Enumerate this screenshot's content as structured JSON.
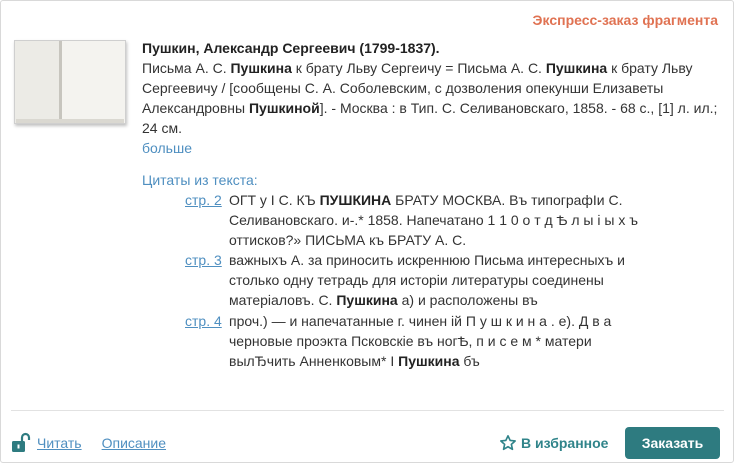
{
  "express_label": "Экспресс-заказ фрагмента",
  "book": {
    "title": "Пушкин, Александр Сергеевич (1799-1837).",
    "desc_parts": [
      {
        "t": "Письма А. С. ",
        "b": false
      },
      {
        "t": "Пушкина",
        "b": true
      },
      {
        "t": " к брату Льву Сергеичу = Письма А. С. ",
        "b": false
      },
      {
        "t": "Пушкина",
        "b": true
      },
      {
        "t": " к брату Льву Сергеевичу / [сообщены С. А. Соболевским, с дозволения опекунши Елизаветы Александровны ",
        "b": false
      },
      {
        "t": "Пушкиной",
        "b": true
      },
      {
        "t": "]. - Москва : в Тип. С. Селивановскаго, 1858. - 68 с., [1] л. ил.; 24 см.",
        "b": false
      }
    ],
    "more_label": "больше"
  },
  "quotes": {
    "title": "Цитаты из текста:",
    "items": [
      {
        "page": "стр. 2",
        "parts": [
          {
            "t": "ОГТ у І С. КЪ ",
            "b": false
          },
          {
            "t": "ПУШКИНА",
            "b": true
          },
          {
            "t": " БРАТУ МОСКВА. Въ типографІи С. Селивановскаго. и-.* 1858. Напечатано 1 1 0 о т д Ѣ л ы і ы х ъ оттисков?» ПИСЬМА къ БРАТУ А. С.",
            "b": false
          }
        ]
      },
      {
        "page": "стр. 3",
        "parts": [
          {
            "t": "важныхъ А. за приносить искреннюю Письма интересныхъ и столько одну тетрадь для исторіи литературы соединены матеріаловъ. С. ",
            "b": false
          },
          {
            "t": "Пушкина",
            "b": true
          },
          {
            "t": " а) и расположены въ",
            "b": false
          }
        ]
      },
      {
        "page": "стр. 4",
        "parts": [
          {
            "t": "проч.) — и напечатанные г. чинен ій П у ш к и н а . е). Д в а черновые проэкта Псковскіе въ ногѢ, п и с е м * матери вылЂчить Анненковым* І ",
            "b": false
          },
          {
            "t": "Пушкина",
            "b": true
          },
          {
            "t": " бъ",
            "b": false
          }
        ]
      }
    ]
  },
  "actions": {
    "read_label": "Читать",
    "description_label": "Описание",
    "favorites_label": "В избранное",
    "order_label": "Заказать"
  },
  "colors": {
    "accent_orange": "#e07252",
    "link_blue": "#4f8fc0",
    "teal": "#2e7b80"
  },
  "icons": {
    "lock": "unlock-icon",
    "star": "star-outline-icon"
  }
}
